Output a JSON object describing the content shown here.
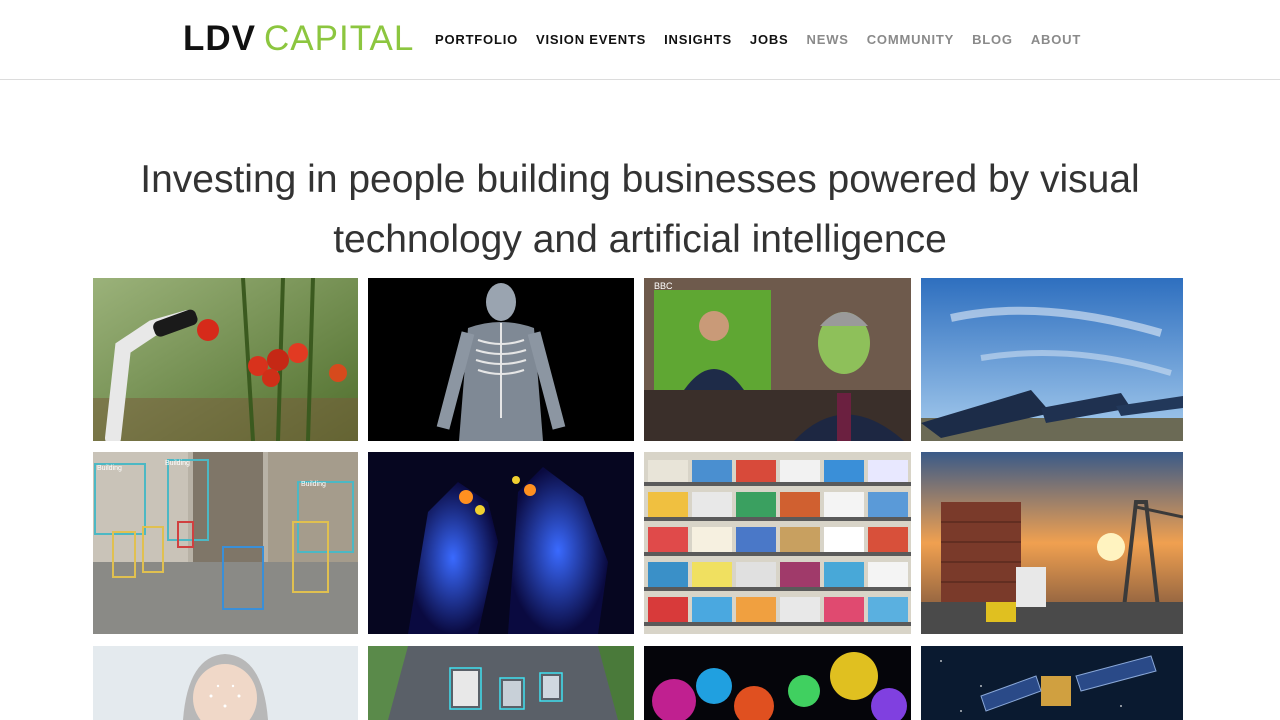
{
  "logo": {
    "bold": "LDV",
    "light": "CAPITAL"
  },
  "nav": [
    {
      "label": "PORTFOLIO",
      "style": "dark"
    },
    {
      "label": "VISION EVENTS",
      "style": "dark"
    },
    {
      "label": "INSIGHTS",
      "style": "dark"
    },
    {
      "label": "JOBS",
      "style": "dark"
    },
    {
      "label": "NEWS",
      "style": "muted"
    },
    {
      "label": "COMMUNITY",
      "style": "muted"
    },
    {
      "label": "BLOG",
      "style": "muted"
    },
    {
      "label": "ABOUT",
      "style": "muted"
    }
  ],
  "hero": {
    "line1": "Investing in people building businesses powered by visual",
    "line2": "technology and artificial intelligence"
  },
  "gallery": {
    "tiles": [
      {
        "name": "robot-arm-tomatoes-image"
      },
      {
        "name": "xray-skeleton-image"
      },
      {
        "name": "news-anchor-greenscreen-image",
        "caption": "BBC"
      },
      {
        "name": "solar-panels-image"
      },
      {
        "name": "street-object-detection-image",
        "labels": [
          "Building",
          "Building",
          "Building"
        ]
      },
      {
        "name": "thermal-wolves-image"
      },
      {
        "name": "supermarket-shelves-image"
      },
      {
        "name": "port-shipping-containers-image"
      },
      {
        "name": "face-recognition-woman-image"
      },
      {
        "name": "autonomous-traffic-image"
      },
      {
        "name": "colorful-lidar-trees-image"
      },
      {
        "name": "satellite-space-image"
      }
    ]
  },
  "colors": {
    "brand_green": "#8cc63f",
    "nav_dark": "#111111",
    "nav_muted": "#8a8a8a"
  }
}
